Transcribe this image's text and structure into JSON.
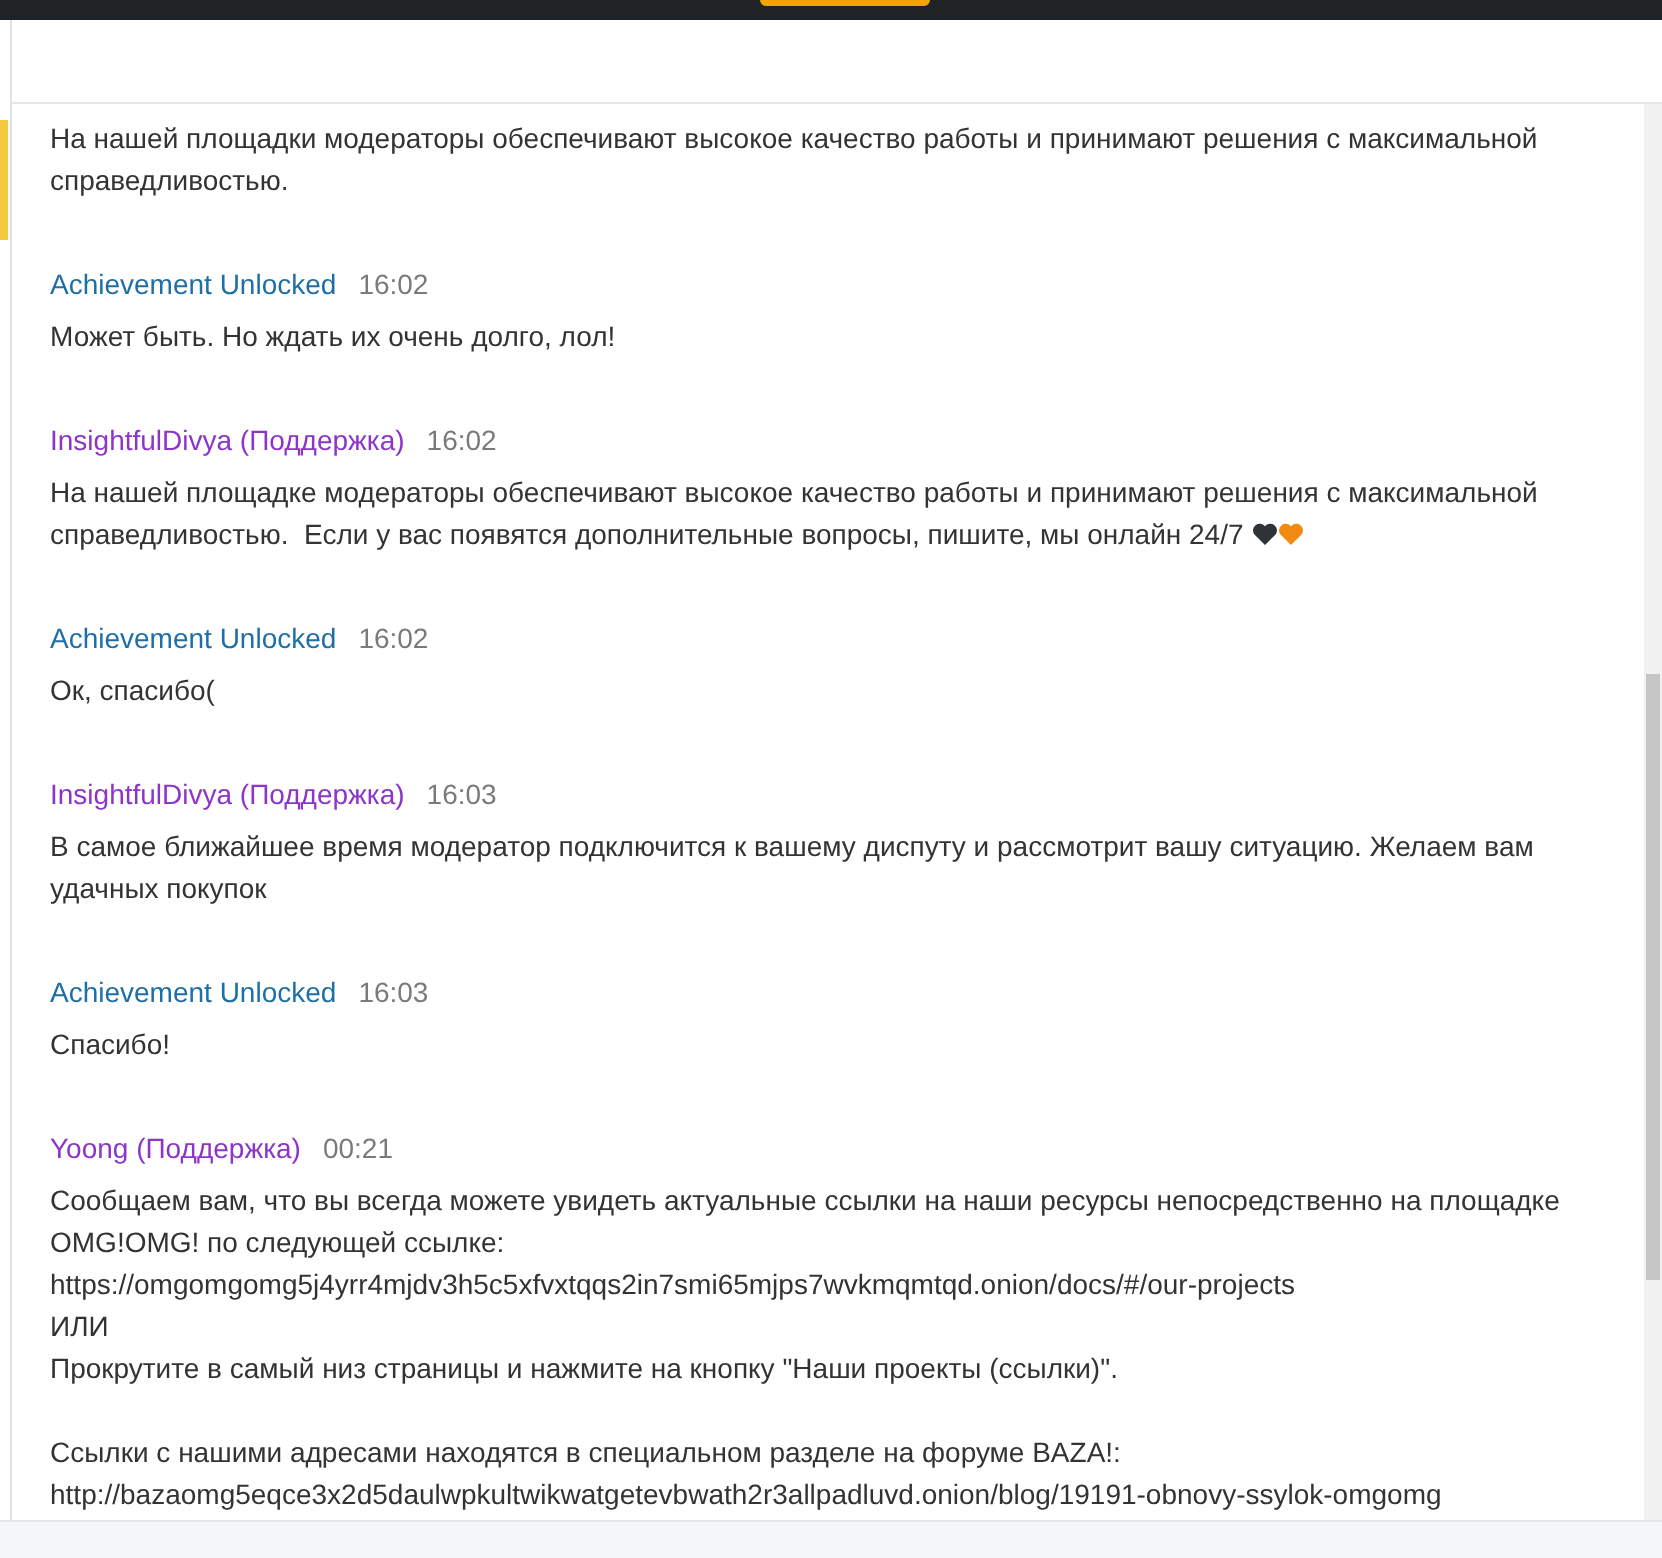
{
  "messages": [
    {
      "text": "На нашей площадки модераторы обеспечивают высокое качество работы и принимают решения с максимальной справедливостью."
    },
    {
      "kind": "user",
      "author": "Achievement Unlocked",
      "time": "16:02",
      "text": "Может быть. Но ждать их очень долго, лол!"
    },
    {
      "kind": "support",
      "author": "InsightfulDivya (Поддержка)",
      "time": "16:02",
      "text": "На нашей площадке модераторы обеспечивают высокое качество работы и принимают решения с максимальной справедливостью.  Если у вас появятся дополнительные вопросы, пишите, мы онлайн 24/7",
      "hearts": true
    },
    {
      "kind": "user",
      "author": "Achievement Unlocked",
      "time": "16:02",
      "text": "Ок, спасибо("
    },
    {
      "kind": "support",
      "author": "InsightfulDivya (Поддержка)",
      "time": "16:03",
      "text": "В самое ближайшее время модератор подключится к вашему диспуту и рассмотрит вашу ситуацию. Желаем вам удачных покупок"
    },
    {
      "kind": "user",
      "author": "Achievement Unlocked",
      "time": "16:03",
      "text": "Спасибо!"
    },
    {
      "kind": "support",
      "author": "Yoong (Поддержка)",
      "time": "00:21",
      "text": "Сообщаем вам, что вы всегда можете увидеть актуальные ссылки на наши ресурсы непосредственно на площадке OMG!OMG! по следующей ссылке:\nhttps://omgomgomg5j4yrr4mjdv3h5c5xfvxtqqs2in7smi65mjps7wvkmqmtqd.onion/docs/#/our-projects\nИЛИ\nПрокрутите в самый низ страницы и нажмите на кнопку \"Наши проекты (ссылки)\".\n\nСсылки с нашими адресами находятся в специальном разделе на форуме BAZA!:\nhttp://bazaomg5eqce3x2d5daulwpkultwikwatgetevbwath2r3allpadluvd.onion/blog/19191-obnovy-ssylok-omgomg"
    }
  ]
}
